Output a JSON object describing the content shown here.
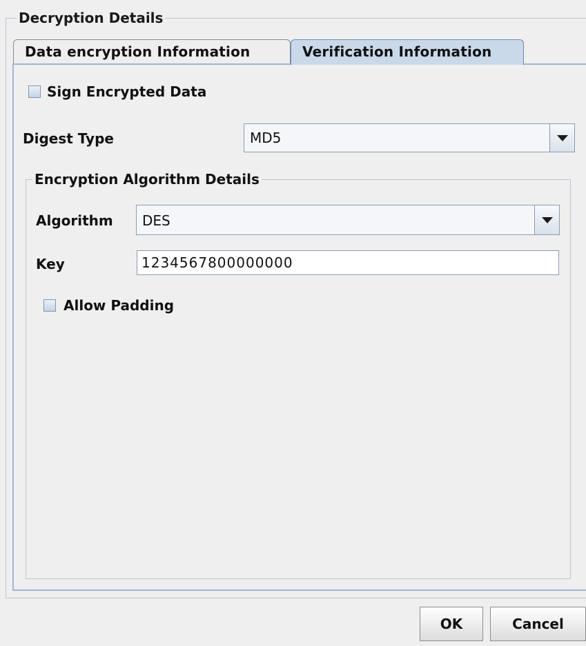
{
  "dialog": {
    "group_title": "Decryption Details",
    "tabs": [
      {
        "label": "Data encryption Information",
        "selected": false
      },
      {
        "label": "Verification Information",
        "selected": true
      }
    ]
  },
  "verification": {
    "sign_checkbox": {
      "label": "Sign Encrypted Data",
      "checked": false
    },
    "digest_type": {
      "label": "Digest Type",
      "value": "MD5"
    },
    "algorithm_group": {
      "title": "Encryption Algorithm Details",
      "algorithm": {
        "label": "Algorithm",
        "value": "DES"
      },
      "key": {
        "label": "Key",
        "value": "1234567800000000"
      },
      "padding_checkbox": {
        "label": "Allow Padding",
        "checked": false
      }
    }
  },
  "buttons": {
    "ok_label": "OK",
    "cancel_label": "Cancel"
  },
  "colors": {
    "selected_tab": "#c9d9ea",
    "panel_border": "#9fb4d3",
    "background": "#efefef"
  }
}
